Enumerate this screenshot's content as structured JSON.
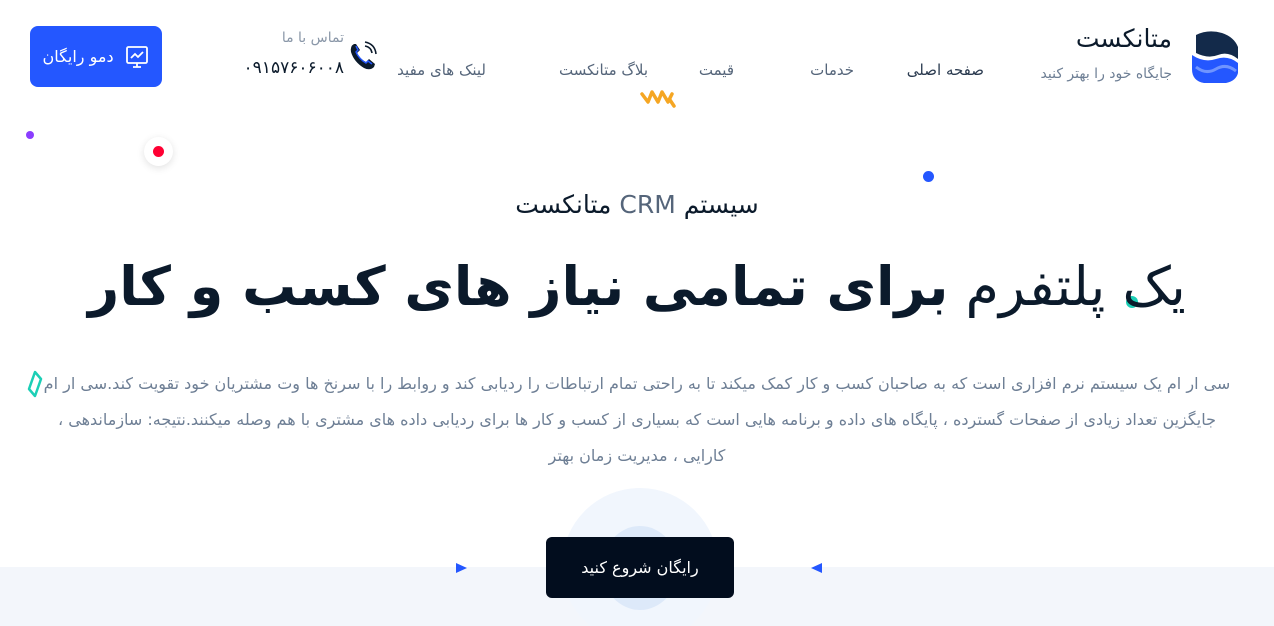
{
  "brand": {
    "name": "متانکست",
    "tagline": "جایگاه خود را بهتر کنید"
  },
  "nav": {
    "items": [
      {
        "label": "صفحه اصلی"
      },
      {
        "label": "خدمات"
      },
      {
        "label": "قیمت"
      },
      {
        "label": "بلاگ متانکست"
      },
      {
        "label": "لینک های مفید"
      }
    ]
  },
  "contact": {
    "label": "تماس با ما",
    "phone": "۰۹۱۵۷۶۰۶۰۰۸",
    "icon": "phone-icon"
  },
  "demo_button": {
    "label": "دمو رایگان",
    "icon": "presentation-icon"
  },
  "hero": {
    "subtitle_prefix": "سیستم ",
    "subtitle_crm": "CRM",
    "subtitle_suffix": " متانکست",
    "headline_light": "یک پلتفرم ",
    "headline_bold": "برای تمامی نیاز های کسب و کار",
    "description": "سی ار ام یک سیستم نرم افزاری است که به صاحبان کسب و کار کمک میکند تا به راحتی تمام ارتباطات را ردیابی کند و روابط را با سرنخ ها وت مشتریان خود تقویت کند.سی ار ام جایگزین تعداد زیادی از صفحات گسترده ، پایگاه های داده و برنامه هایی است که بسیاری از کسب و کار ها برای ردیابی داده های مشتری با هم وصله میکنند.نتیجه: سازماندهی ، کارایی ، مدیریت زمان بهتر"
  },
  "cta": {
    "label": "رایگان شروع کنید"
  },
  "colors": {
    "primary": "#2457ff",
    "dark": "#020d1e",
    "teal": "#1ccfb6",
    "red": "#ff0033",
    "purple": "#8b3dff",
    "orange": "#f5a623"
  }
}
